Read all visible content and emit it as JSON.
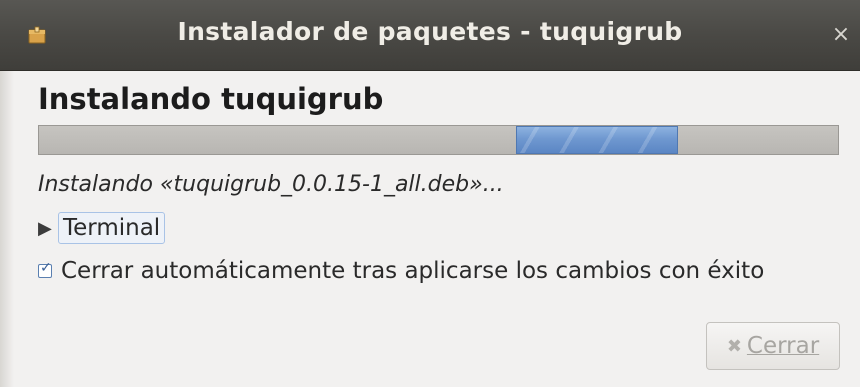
{
  "window": {
    "title": "Instalador de paquetes - tuquigrub",
    "close_glyph": "×",
    "app_icon": "package-icon"
  },
  "main": {
    "heading": "Instalando tuquigrub",
    "progress": {
      "state": "indeterminate-pulse",
      "pulse_color": "#6f98d0"
    },
    "status": "Instalando «tuquigrub_0.0.15-1_all.deb»...",
    "expander": {
      "arrow": "▶",
      "label": "Terminal",
      "expanded": false
    },
    "auto_close": {
      "checked": true,
      "mark": "✓",
      "label": "Cerrar automáticamente tras aplicarse los cambios con éxito"
    }
  },
  "footer": {
    "close_button": {
      "icon": "✖",
      "icon_name": "close-x-icon",
      "label": "Cerrar",
      "enabled": false
    }
  },
  "colors": {
    "titlebar": "#4a4945",
    "title_text": "#f0ede6",
    "window_bg": "#f2f1f0",
    "progress_track": "#c0beba",
    "progress_pulse": "#6f98d0"
  }
}
